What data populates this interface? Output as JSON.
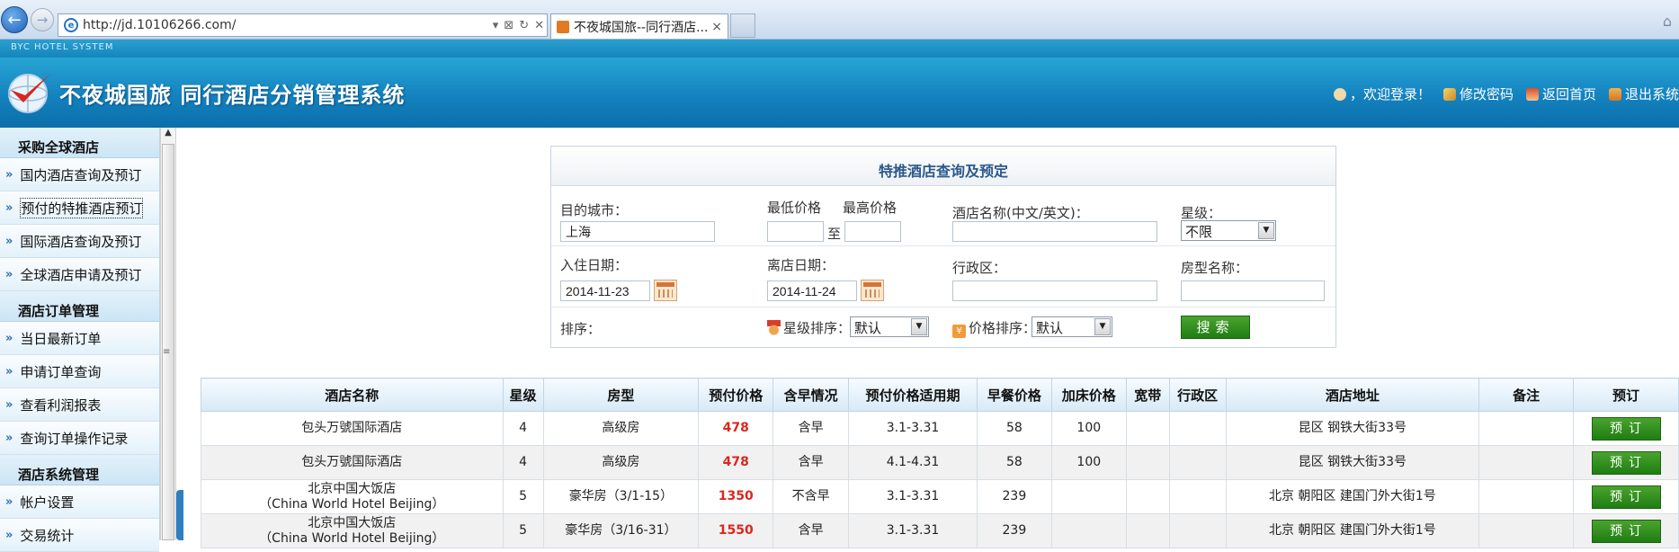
{
  "browser": {
    "url": "http://jd.10106266.com/",
    "tab_title": "不夜城国旅--同行酒店...",
    "tab_close": "×",
    "address_controls": [
      "▾",
      "⊠",
      "↻",
      "✕"
    ]
  },
  "header": {
    "system_tag": "BYC HOTEL SYSTEM",
    "title": "不夜城国旅  同行酒店分销管理系统",
    "welcome": "，欢迎登录！",
    "change_password": "修改密码",
    "home": "返回首页",
    "logout": "退出系统"
  },
  "sidebar": {
    "sections": [
      {
        "title": "采购全球酒店",
        "items": [
          "国内酒店查询及预订",
          "预付的特推酒店预订",
          "国际酒店查询及预订",
          "全球酒店申请及预订"
        ]
      },
      {
        "title": "酒店订单管理",
        "items": [
          "当日最新订单",
          "申请订单查询",
          "查看利润报表",
          "查询订单操作记录"
        ]
      },
      {
        "title": "酒店系统管理",
        "items": [
          "帐户设置",
          "交易统计"
        ]
      }
    ],
    "active_item": "预付的特推酒店预订",
    "arrow": "»"
  },
  "search": {
    "title": "特推酒店查询及预定",
    "dest_label": "目的城市：",
    "dest_value": "上海",
    "min_price_label": "最低价格",
    "max_price_label": "最高价格",
    "to": "至",
    "hotel_name_label": "酒店名称(中文/英文)：",
    "star_label": "星级：",
    "star_value": "不限",
    "checkin_label": "入住日期：",
    "checkin_value": "2014-11-23",
    "checkout_label": "离店日期：",
    "checkout_value": "2014-11-24",
    "district_label": "行政区：",
    "room_name_label": "房型名称：",
    "sort_label": "排序：",
    "star_sort_label": "星级排序：",
    "star_sort_value": "默认",
    "price_sort_label": "价格排序：",
    "price_sort_value": "默认",
    "yuan_glyph": "¥",
    "button": "搜索"
  },
  "table": {
    "headers": [
      "酒店名称",
      "星级",
      "房型",
      "预付价格",
      "含早情况",
      "预付价格适用期",
      "早餐价格",
      "加床价格",
      "宽带",
      "行政区",
      "酒店地址",
      "备注",
      "预订"
    ],
    "book_label": "预订",
    "rows": [
      {
        "name": "包头万號国际酒店",
        "name2": "",
        "star": "4",
        "room": "高级房",
        "price": "478",
        "breakfast": "含早",
        "period": "3.1-3.31",
        "bf_price": "58",
        "extra_bed": "100",
        "broadband": "",
        "district": "",
        "address": "昆区 钢铁大街33号",
        "remark": ""
      },
      {
        "name": "包头万號国际酒店",
        "name2": "",
        "star": "4",
        "room": "高级房",
        "price": "478",
        "breakfast": "含早",
        "period": "4.1-4.31",
        "bf_price": "58",
        "extra_bed": "100",
        "broadband": "",
        "district": "",
        "address": "昆区 钢铁大街33号",
        "remark": ""
      },
      {
        "name": "北京中国大饭店",
        "name2": "（China World Hotel Beijing）",
        "star": "5",
        "room": "豪华房（3/1-15）",
        "price": "1350",
        "breakfast": "不含早",
        "period": "3.1-3.31",
        "bf_price": "239",
        "extra_bed": "",
        "broadband": "",
        "district": "",
        "address": "北京 朝阳区 建国门外大街1号",
        "remark": ""
      },
      {
        "name": "北京中国大饭店",
        "name2": "（China World Hotel Beijing）",
        "star": "5",
        "room": "豪华房（3/16-31）",
        "price": "1550",
        "breakfast": "含早",
        "period": "3.1-3.31",
        "bf_price": "239",
        "extra_bed": "",
        "broadband": "",
        "district": "",
        "address": "北京 朝阳区 建国门外大街1号",
        "remark": ""
      }
    ]
  },
  "colors": {
    "banner": "#1482bf",
    "price": "#d9281f",
    "button_green": "#2e8f1c"
  }
}
